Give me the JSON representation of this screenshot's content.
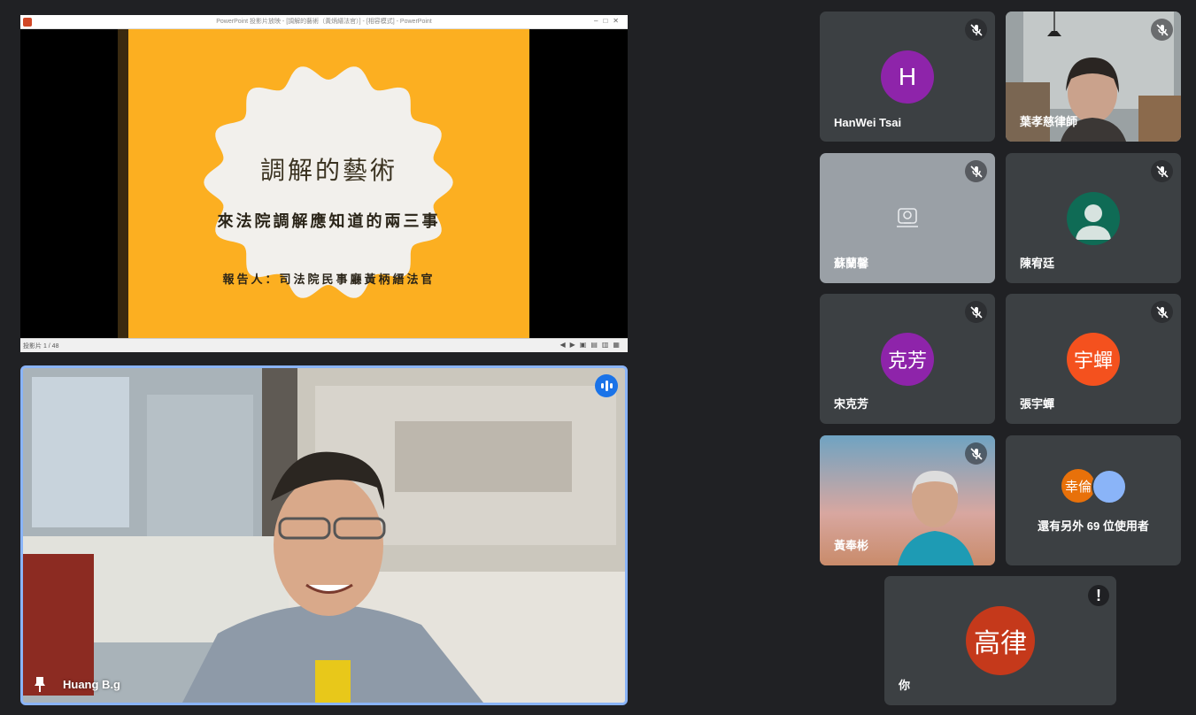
{
  "presentation": {
    "window_title": "PowerPoint 投影片放映 - [調解的藝術（黃炳縉法官）] - [相容模式] - PowerPoint",
    "slide": {
      "title": "調解的藝術",
      "subtitle": "來法院調解應知道的兩三事",
      "reporter": "報告人：司法院民事廳黃柄縉法官",
      "background_color": "#fcaf21"
    },
    "status_text": "投影片 1 / 48"
  },
  "speaker": {
    "name": "Huang B.g",
    "speaking": true
  },
  "participants": [
    {
      "name": "HanWei Tsai",
      "type": "avatar",
      "initial": "H",
      "avatar_color": "#8e24aa",
      "muted": true
    },
    {
      "name": "葉孝慈律師",
      "type": "video",
      "muted": true
    },
    {
      "name": "蘇蘭馨",
      "type": "camera-off",
      "muted": true
    },
    {
      "name": "陳宥廷",
      "type": "default-avatar",
      "avatar_color": "#0f6b55",
      "muted": true
    },
    {
      "name": "宋克芳",
      "type": "avatar",
      "initial": "克芳",
      "avatar_color": "#8e24aa",
      "muted": true
    },
    {
      "name": "張宇蟬",
      "type": "avatar",
      "initial": "宇蟬",
      "avatar_color": "#f4511e",
      "muted": true
    },
    {
      "name": "黃奉彬",
      "type": "video",
      "muted": true
    }
  ],
  "more_users": {
    "avatar_label": "幸倫",
    "text": "還有另外 69 位使用者"
  },
  "self": {
    "name": "你",
    "initial": "高律",
    "avatar_color": "#c5391b",
    "alert": "!"
  }
}
